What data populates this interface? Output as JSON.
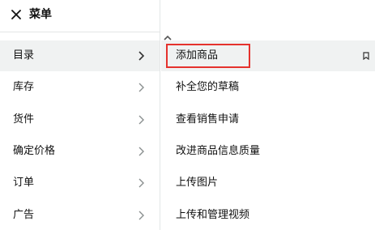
{
  "header": {
    "title": "菜单",
    "close_icon": "close-icon"
  },
  "menu": {
    "items": [
      {
        "label": "目录",
        "active": true
      },
      {
        "label": "库存",
        "active": false
      },
      {
        "label": "货件",
        "active": false
      },
      {
        "label": "确定价格",
        "active": false
      },
      {
        "label": "订单",
        "active": false
      },
      {
        "label": "广告",
        "active": false
      }
    ]
  },
  "submenu": {
    "items": [
      {
        "label": "添加商品",
        "active": true,
        "highlighted": true
      },
      {
        "label": "补全您的草稿",
        "active": false
      },
      {
        "label": "查看销售申请",
        "active": false
      },
      {
        "label": "改进商品信息质量",
        "active": false
      },
      {
        "label": "上传图片",
        "active": false
      },
      {
        "label": "上传和管理视频",
        "active": false
      }
    ]
  },
  "colors": {
    "highlight": "#e5322d",
    "active_bg": "#f0f2f2",
    "topbar": "#232f2e",
    "divider": "#e3e6e6"
  },
  "icons": {
    "chevron": "chevron-right-icon",
    "scroll_up": "scroll-up-icon",
    "bookmark": "bookmark-icon"
  }
}
